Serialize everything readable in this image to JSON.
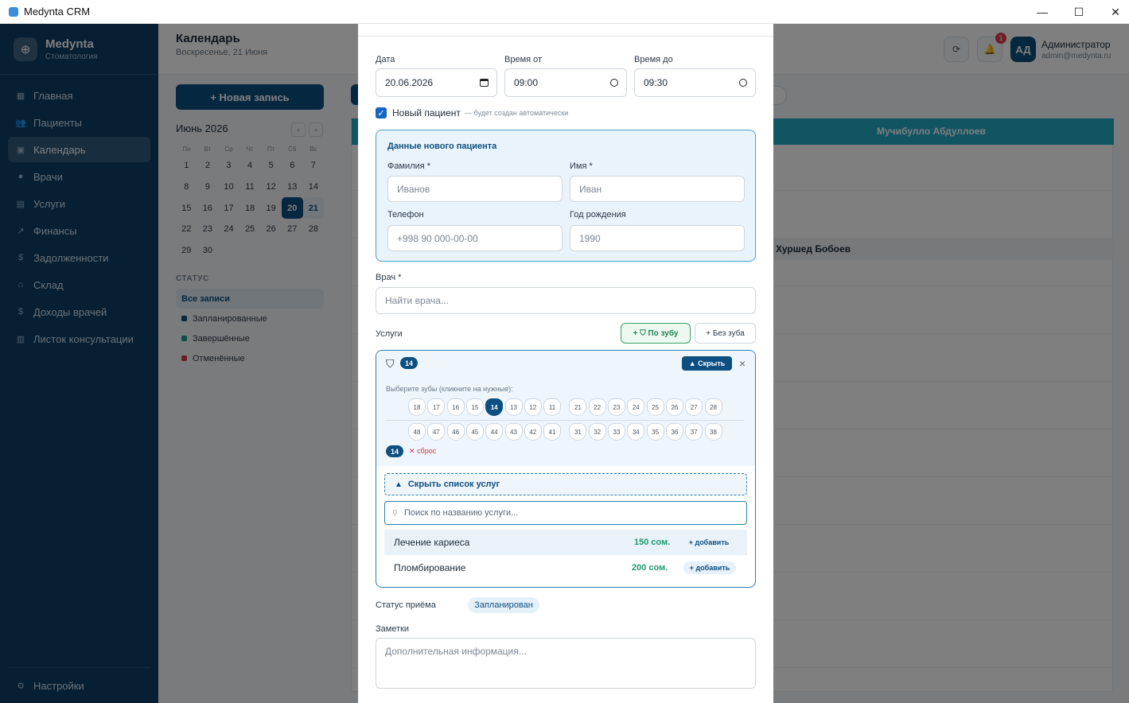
{
  "window": {
    "title": "Medynta CRM",
    "minimize": "—",
    "maximize": "☐",
    "close": "✕"
  },
  "sidebar": {
    "brand": "Medynta",
    "brand_sub": "Стоматология",
    "items": [
      {
        "label": "Главная",
        "icon": "dashboard-icon"
      },
      {
        "label": "Пациенты",
        "icon": "users-icon"
      },
      {
        "label": "Календарь",
        "icon": "calendar-icon"
      },
      {
        "label": "Врачи",
        "icon": "doctor-icon"
      },
      {
        "label": "Услуги",
        "icon": "services-icon"
      },
      {
        "label": "Финансы",
        "icon": "chart-icon"
      },
      {
        "label": "Задолженности",
        "icon": "dollar-icon"
      },
      {
        "label": "Склад",
        "icon": "warehouse-icon"
      },
      {
        "label": "Доходы врачей",
        "icon": "dollar-icon"
      },
      {
        "label": "Листок консультации",
        "icon": "document-icon"
      }
    ],
    "settings": "Настройки"
  },
  "header": {
    "title": "Календарь",
    "subtitle": "Воскресенье, 21 Июня",
    "notif_count": "1",
    "avatar_initials": "АД",
    "user_name": "Администратор",
    "user_email": "admin@medynta.ru"
  },
  "left_panel": {
    "new_button": "+ Новая запись",
    "month": "Июнь 2026",
    "prev": "‹",
    "next": "›",
    "weekdays": [
      "Пн",
      "Вт",
      "Ср",
      "Чт",
      "Пт",
      "Сб",
      "Вс"
    ],
    "days": [
      "1",
      "2",
      "3",
      "4",
      "5",
      "6",
      "7",
      "8",
      "9",
      "10",
      "11",
      "12",
      "13",
      "14",
      "15",
      "16",
      "17",
      "18",
      "19",
      "20",
      "21",
      "22",
      "23",
      "24",
      "25",
      "26",
      "27",
      "28",
      "29",
      "30"
    ],
    "status_heading": "СТАТУС",
    "status_all": "Все записи",
    "statuses": [
      {
        "label": "Запланированные",
        "color": "#0d4f80"
      },
      {
        "label": "Завершённые",
        "color": "#1f9a8a"
      },
      {
        "label": "Отменённые",
        "color": "#d63649"
      }
    ]
  },
  "schedule": {
    "doctor_header": "Мучибулло Абдуллоев",
    "appointment": "Хуршед Бобоев"
  },
  "modal": {
    "date_label": "Дата",
    "date_value": "20.06.2026",
    "time_from_label": "Время от",
    "time_from_value": "09:00",
    "time_to_label": "Время до",
    "time_to_value": "09:30",
    "new_patient_label": "Новый пациент",
    "new_patient_hint": "— будет создан автоматически",
    "patient_box_title": "Данные нового пациента",
    "last_name_label": "Фамилия *",
    "last_name_placeholder": "Иванов",
    "first_name_label": "Имя *",
    "first_name_placeholder": "Иван",
    "phone_label": "Телефон",
    "phone_placeholder": "+998 90 000-00-00",
    "birth_label": "Год рождения",
    "birth_placeholder": "1990",
    "doctor_label": "Врач *",
    "doctor_placeholder": "Найти врача...",
    "services_label": "Услуги",
    "by_tooth_button": "По зубу",
    "no_tooth_button": "Без зуба",
    "tooth_chip": "14",
    "hide_button": "▲ Скрыть",
    "close": "×",
    "choose_teeth_hint": "Выберите зубы (кликните на нужные):",
    "upper_teeth": [
      "18",
      "17",
      "16",
      "15",
      "14",
      "13",
      "12",
      "11",
      "21",
      "22",
      "23",
      "24",
      "25",
      "26",
      "27",
      "28"
    ],
    "lower_teeth": [
      "48",
      "47",
      "46",
      "45",
      "44",
      "43",
      "42",
      "41",
      "31",
      "32",
      "33",
      "34",
      "35",
      "36",
      "37",
      "38"
    ],
    "selected_tooth": "14",
    "reset_label": "сброс",
    "hide_list_label": "Скрыть список услуг",
    "search_placeholder": "Поиск по названию услуги...",
    "services": [
      {
        "name": "Лечение кариеса",
        "price": "150 сом.",
        "add": "+ добавить"
      },
      {
        "name": "Пломбирование",
        "price": "200 сом.",
        "add": "+ добавить"
      }
    ],
    "status_label": "Статус приёма",
    "status_value": "Запланирован",
    "notes_label": "Заметки",
    "notes_placeholder": "Дополнительная информация..."
  }
}
